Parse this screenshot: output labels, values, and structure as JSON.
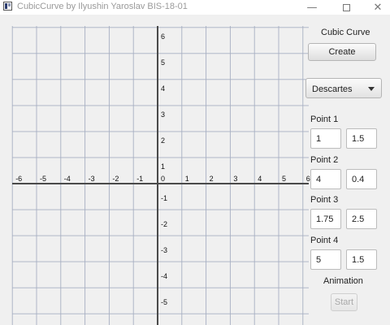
{
  "window": {
    "title": "CubicCurve by Ilyushin Yaroslav BIS-18-01",
    "minimize": "—",
    "close": "✕"
  },
  "graph": {
    "x_ticks": [
      "-6",
      "-5",
      "-4",
      "-3",
      "-2",
      "-1",
      "0",
      "1",
      "2",
      "3",
      "4",
      "5",
      "6"
    ],
    "y_ticks_positive": [
      "6",
      "5",
      "4",
      "3",
      "2",
      "1"
    ],
    "y_ticks_negative": [
      "-1",
      "-2",
      "-3",
      "-4",
      "-5"
    ],
    "grid_color": "#a7afc2",
    "axis_color": "#4a4a4a"
  },
  "panel": {
    "heading": "Cubic Curve",
    "create_label": "Create",
    "coord_mode": "Descartes",
    "points": [
      {
        "label": "Point 1",
        "x": "1",
        "y": "1.5"
      },
      {
        "label": "Point 2",
        "x": "4",
        "y": "0.4"
      },
      {
        "label": "Point 3",
        "x": "1.75",
        "y": "2.5"
      },
      {
        "label": "Point 4",
        "x": "5",
        "y": "1.5"
      }
    ],
    "animation_label": "Animation",
    "start_label": "Start"
  }
}
